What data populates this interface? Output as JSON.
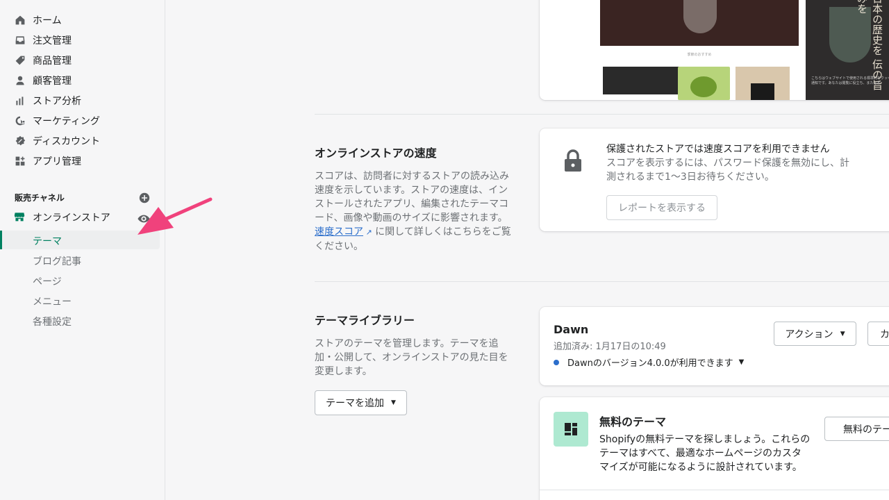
{
  "sidebar": {
    "items": [
      {
        "label": "ホーム",
        "icon": "home-icon"
      },
      {
        "label": "注文管理",
        "icon": "orders-icon"
      },
      {
        "label": "商品管理",
        "icon": "tag-icon"
      },
      {
        "label": "顧客管理",
        "icon": "customer-icon"
      },
      {
        "label": "ストア分析",
        "icon": "analytics-icon"
      },
      {
        "label": "マーケティング",
        "icon": "marketing-icon"
      },
      {
        "label": "ディスカウント",
        "icon": "discount-icon"
      },
      {
        "label": "アプリ管理",
        "icon": "apps-icon"
      }
    ],
    "channels_label": "販売チャネル",
    "online_store": "オンラインストア",
    "sub_items": [
      "テーマ",
      "ブログ記事",
      "ページ",
      "メニュー",
      "各種設定"
    ],
    "active_sub": "テーマ"
  },
  "speed": {
    "title": "オンラインストアの速度",
    "desc_before": "スコアは、訪問者に対するストアの読み込み速度を示しています。ストアの速度は、インストールされたアプリ、編集されたテーマコード、画像や動画のサイズに影響されます。",
    "link": "速度スコア",
    "desc_after": " に関して詳しくはこちらをご覧ください。",
    "card_title": "保護されたストアでは速度スコアを利用できません",
    "card_desc": "スコアを表示するには、パスワード保護を無効にし、計測されるまで1〜3日お待ちください。",
    "report_btn": "レポートを表示する"
  },
  "library": {
    "title": "テーマライブラリー",
    "desc": "ストアのテーマを管理します。テーマを追加・公開して、オンラインストアの見た目を変更します。",
    "add_btn": "テーマを追加"
  },
  "theme": {
    "name": "Dawn",
    "added": "追加済み: 1月17日の10:49",
    "version": "Dawnのバージョン4.0.0が利用できます",
    "action_btn": "アクション",
    "customize_btn": "カ"
  },
  "free": {
    "title": "無料のテーマ",
    "desc": "Shopifyの無料テーマを探しましょう。これらのテーマはすべて、最適なホームページのカスタマイズが可能になるように設計されています。",
    "btn": "無料のテー"
  },
  "preview": {
    "caption": "季節のおすすめ",
    "vertical_text": "日本の歴史を 伝の旨みを",
    "small_text": "こちらはウェブサイトで使用される標準的なクッキー通知です。あなたは閲覧に役立ち、または本"
  },
  "colors": {
    "accent": "#008060",
    "arrow": "#f0427c",
    "link": "#2c6ecb"
  }
}
